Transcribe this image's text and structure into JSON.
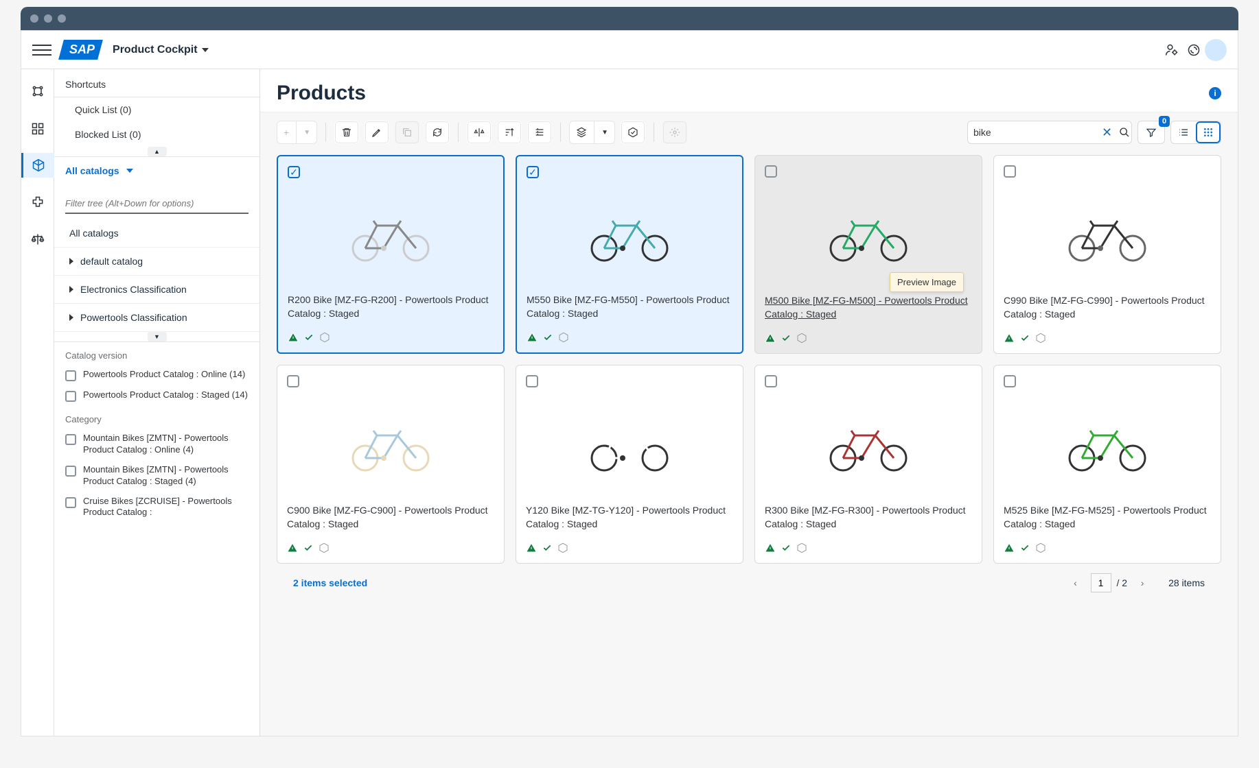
{
  "app_title": "Product Cockpit",
  "sidebar": {
    "shortcuts_label": "Shortcuts",
    "quick_list": "Quick List (0)",
    "blocked_list": "Blocked List (0)",
    "all_catalogs_header": "All catalogs",
    "filter_tree_placeholder": "Filter tree (Alt+Down for options)",
    "tree": {
      "all_catalogs": "All catalogs",
      "default_catalog": "default catalog",
      "electronics": "Electronics Classification",
      "powertools": "Powertools Classification"
    },
    "facets": {
      "catalog_version_title": "Catalog version",
      "catalog_version_items": [
        "Powertools Product Catalog : Online (14)",
        "Powertools Product Catalog : Staged (14)"
      ],
      "category_title": "Category",
      "category_items": [
        "Mountain Bikes [ZMTN] - Powertools Product Catalog : Online (4)",
        "Mountain Bikes [ZMTN] - Powertools Product Catalog : Staged (4)",
        "Cruise Bikes [ZCRUISE] - Powertools Product Catalog :"
      ]
    }
  },
  "main": {
    "title": "Products",
    "search_value": "bike",
    "filter_count": "0",
    "tooltip_text": "Preview Image",
    "selected_text": "2 items selected",
    "page_current": "1",
    "page_of": "/ 2",
    "total_items": "28 items"
  },
  "products": [
    {
      "title": "R200 Bike [MZ-FG-R200] - Powertools Product Catalog : Staged",
      "selected": true,
      "hover": false,
      "color1": "#888",
      "color2": "#ccc"
    },
    {
      "title": "M550 Bike [MZ-FG-M550] - Powertools Product Catalog : Staged",
      "selected": true,
      "hover": false,
      "color1": "#4aa",
      "color2": "#333"
    },
    {
      "title": "M500 Bike [MZ-FG-M500] - Powertools Product Catalog : Staged",
      "selected": false,
      "hover": true,
      "color1": "#2a6",
      "color2": "#333"
    },
    {
      "title": "C990 Bike [MZ-FG-C990] - Powertools Product Catalog : Staged",
      "selected": false,
      "hover": false,
      "color1": "#333",
      "color2": "#666"
    },
    {
      "title": "C900 Bike [MZ-FG-C900] - Powertools Product Catalog : Staged",
      "selected": false,
      "hover": false,
      "color1": "#a8c8dd",
      "color2": "#e8d8b8"
    },
    {
      "title": "Y120 Bike [MZ-TG-Y120] - Powertools Product Catalog : Staged",
      "selected": false,
      "hover": false,
      "color1": "#fff",
      "color2": "#333"
    },
    {
      "title": "R300 Bike [MZ-FG-R300] - Powertools Product Catalog : Staged",
      "selected": false,
      "hover": false,
      "color1": "#a33",
      "color2": "#333"
    },
    {
      "title": "M525 Bike [MZ-FG-M525] - Powertools Product Catalog : Staged",
      "selected": false,
      "hover": false,
      "color1": "#3a3",
      "color2": "#333"
    }
  ]
}
